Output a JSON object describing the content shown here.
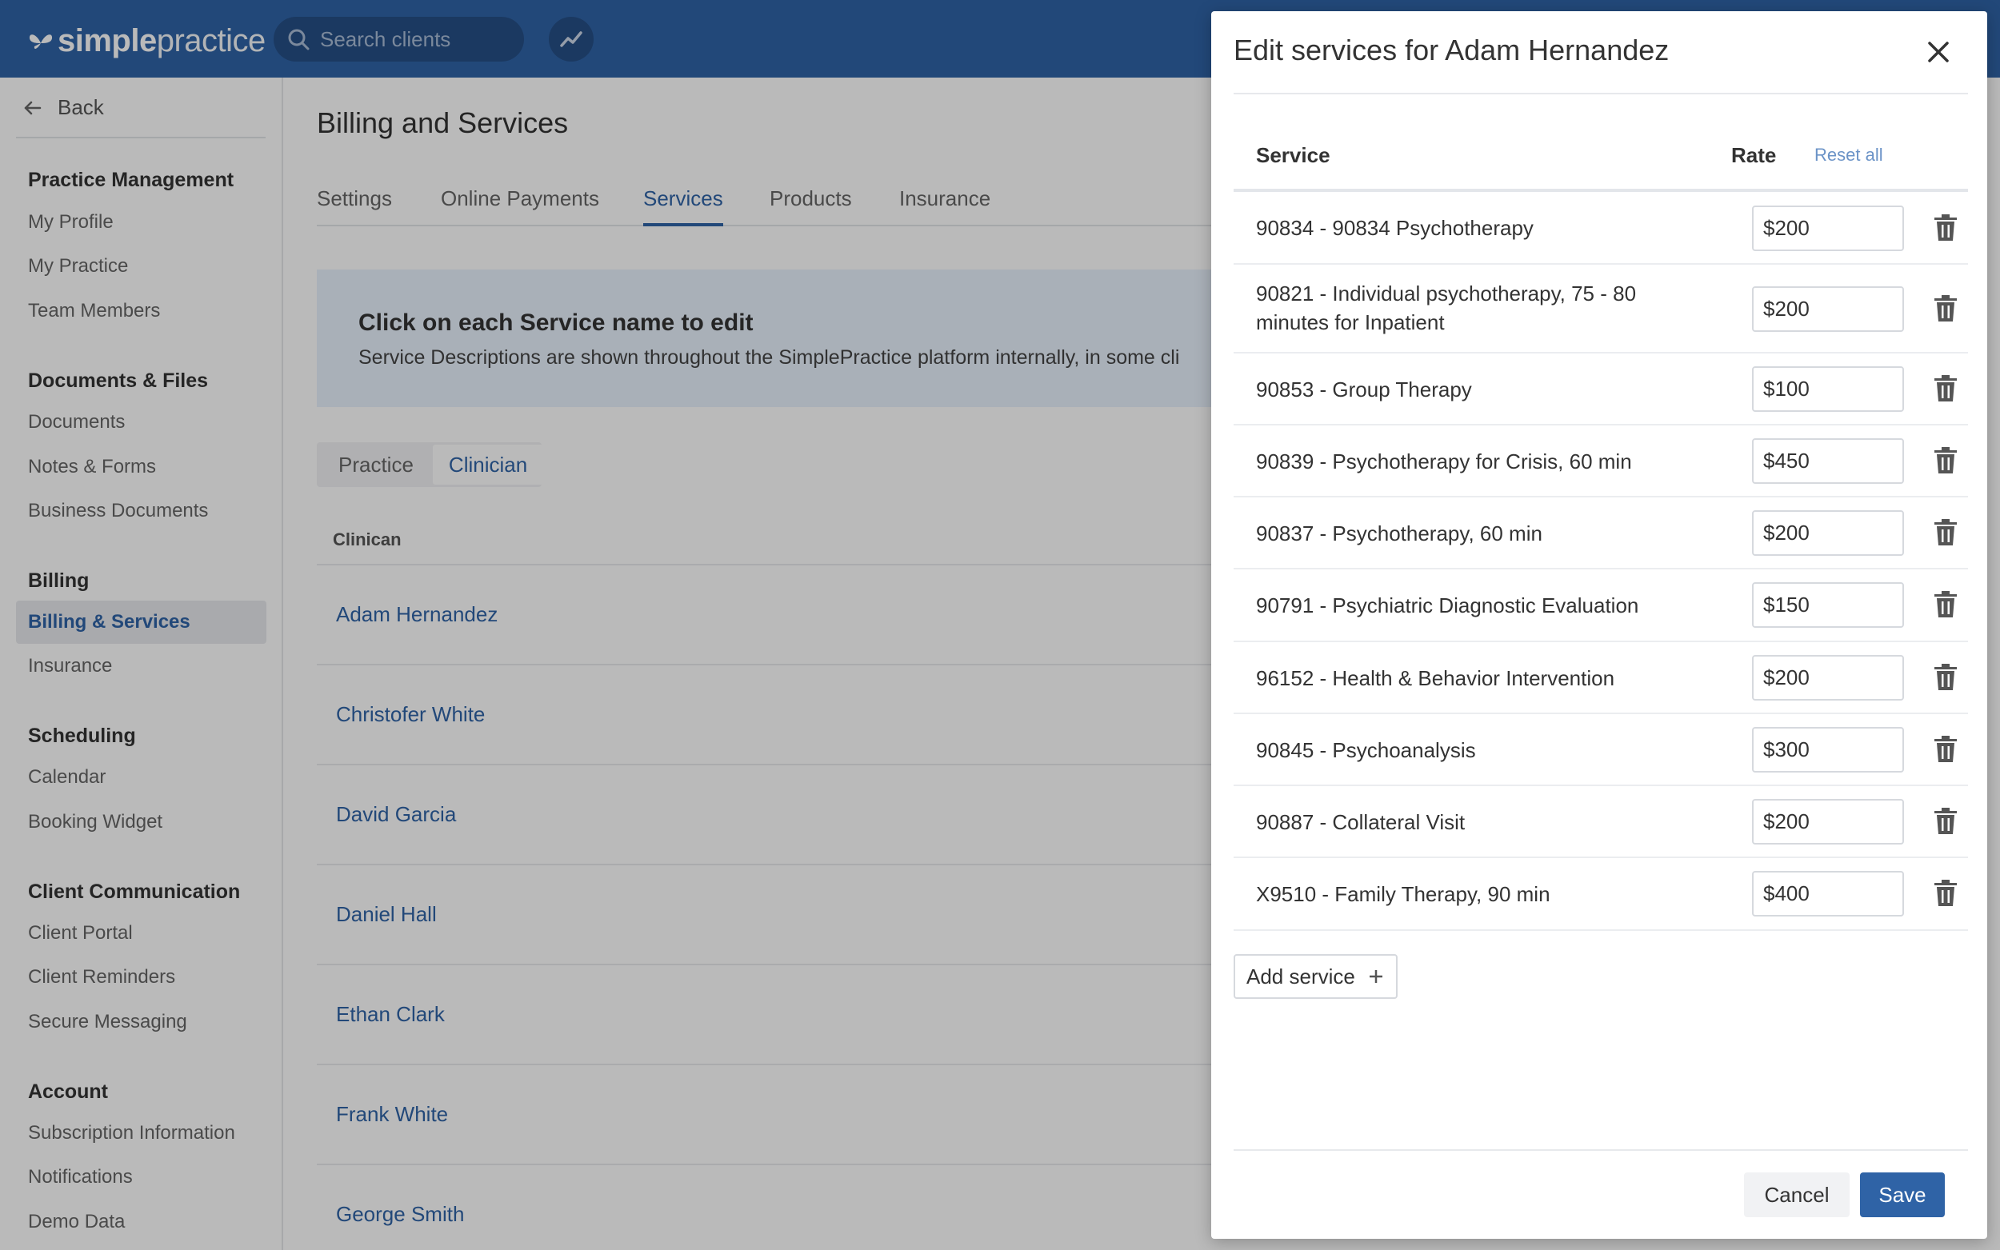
{
  "app": {
    "logo_bold": "simple",
    "logo_light": "practice",
    "search_placeholder": "Search clients"
  },
  "sidebar": {
    "back_label": "Back",
    "sections": [
      {
        "title": "Practice Management",
        "items": [
          "My Profile",
          "My Practice",
          "Team Members"
        ]
      },
      {
        "title": "Documents & Files",
        "items": [
          "Documents",
          "Notes & Forms",
          "Business Documents"
        ]
      },
      {
        "title": "Billing",
        "items": [
          "Billing & Services",
          "Insurance"
        ]
      },
      {
        "title": "Scheduling",
        "items": [
          "Calendar",
          "Booking Widget"
        ]
      },
      {
        "title": "Client Communication",
        "items": [
          "Client Portal",
          "Client Reminders",
          "Secure Messaging"
        ]
      },
      {
        "title": "Account",
        "items": [
          "Subscription Information",
          "Notifications",
          "Demo Data"
        ]
      }
    ],
    "active_item": "Billing & Services"
  },
  "main": {
    "title": "Billing and Services",
    "tabs": [
      "Settings",
      "Online Payments",
      "Services",
      "Products",
      "Insurance"
    ],
    "active_tab": "Services",
    "banner_title": "Click on each Service name to edit",
    "banner_text": "Service Descriptions are shown throughout the SimplePractice platform internally, in some cli",
    "toggle": [
      "Practice",
      "Clinician"
    ],
    "toggle_active": "Clinician",
    "column_header": "Clinican",
    "clinicians": [
      "Adam Hernandez",
      "Christofer White",
      "David Garcia",
      "Daniel Hall",
      "Ethan Clark",
      "Frank White",
      "George Smith"
    ]
  },
  "modal": {
    "title": "Edit services for Adam Hernandez",
    "col_service": "Service",
    "col_rate": "Rate",
    "reset_all": "Reset all",
    "services": [
      {
        "name": "90834 - 90834 Psychotherapy",
        "rate": "$200"
      },
      {
        "name": "90821 - Individual psychotherapy, 75 - 80 minutes for Inpatient",
        "rate": "$200"
      },
      {
        "name": "90853 - Group Therapy",
        "rate": "$100"
      },
      {
        "name": "90839 - Psychotherapy for Crisis, 60 min",
        "rate": "$450"
      },
      {
        "name": "90837 - Psychotherapy, 60 min",
        "rate": "$200"
      },
      {
        "name": "90791 - Psychiatric Diagnostic Evaluation",
        "rate": "$150"
      },
      {
        "name": "96152 - Health & Behavior Intervention",
        "rate": "$200"
      },
      {
        "name": "90845 - Psychoanalysis",
        "rate": "$300"
      },
      {
        "name": "90887 - Collateral Visit",
        "rate": "$200"
      },
      {
        "name": "X9510 - Family Therapy, 90 min",
        "rate": "$400"
      }
    ],
    "add_service_label": "Add service",
    "cancel_label": "Cancel",
    "save_label": "Save"
  },
  "colors": {
    "brand_blue": "#2f63a6",
    "topbar": "#2f63a6",
    "link": "#2f63a6"
  },
  "icons": [
    "butterfly-logo-icon",
    "search-icon",
    "trend-icon",
    "arrow-left-icon",
    "close-icon",
    "trash-icon",
    "plus-icon"
  ]
}
